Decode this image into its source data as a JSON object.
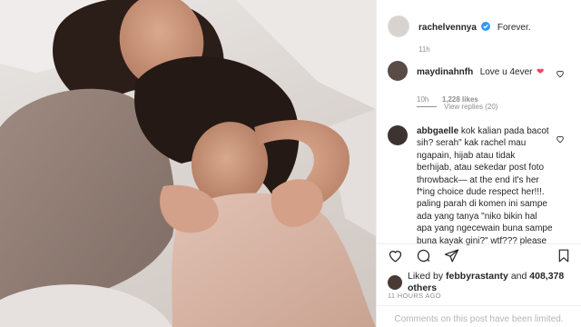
{
  "post": {
    "author": "rachelvennya",
    "caption": "Forever.",
    "caption_time": "11h"
  },
  "comments": [
    {
      "username": "maydinahnfh",
      "text": "Love u 4ever",
      "emoji": "❤",
      "time": "10h",
      "likes": "1,228 likes",
      "view_replies": "View replies (20)"
    },
    {
      "username": "abbgaelle",
      "lines": [
        "kok kalian pada bacot",
        "sih? serah\" kak rachel mau",
        "ngapain, hijab atau tidak",
        "berhijab, atau sekedar post foto",
        "throwback— at the end it's her",
        "f*ing choice dude respect her!!!.",
        "paling parah di komen ini sampe",
        "ada yang tanya \"niko bikin hal",
        "apa yang ngecewain buna sampe",
        "buna kayak gini?\" wtf??? please"
      ]
    }
  ],
  "likes": {
    "prefix": "Liked by",
    "by_user": "febbyrastanty",
    "and": "and",
    "others": "408,378 others"
  },
  "timestamp": "11 HOURS AGO",
  "comments_limited": "Comments on this post have been limited.",
  "icons": [
    "heart-icon",
    "comment-icon",
    "share-icon",
    "bookmark-icon",
    "verified-icon"
  ],
  "colors": {
    "verified": "#3897f0",
    "heart_red": "#ed4956",
    "muted": "#8e8e8e"
  }
}
